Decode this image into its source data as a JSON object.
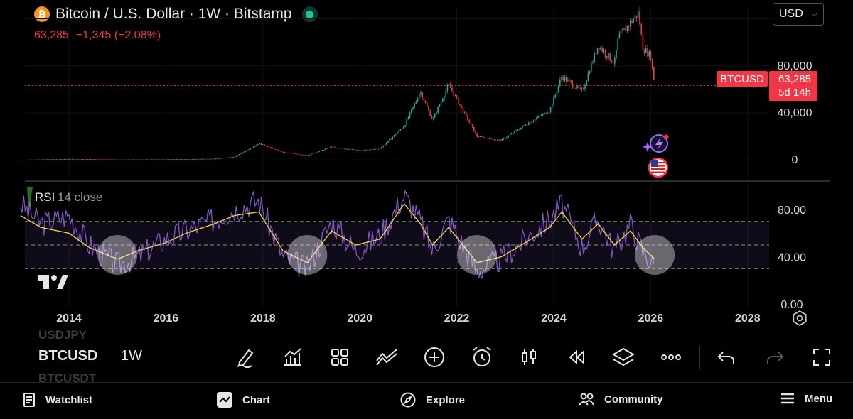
{
  "header": {
    "btc_symbol": "₿",
    "title": "Bitcoin / U.S. Dollar · 1W · Bitstamp",
    "last_price": "63,285",
    "change": "−1,345 (−2.08%)"
  },
  "currency_select": {
    "value": "USD"
  },
  "price_badge": {
    "symbol": "BTCUSD",
    "price": "63,285",
    "countdown": "5d 14h"
  },
  "price_axis": {
    "labels": [
      "80,000",
      "40,000",
      "0"
    ]
  },
  "rsi_axis": {
    "labels": [
      "80.00",
      "40.00",
      "0.00"
    ]
  },
  "rsi_legend": {
    "name": "RSI",
    "params": "14 close"
  },
  "time_axis": {
    "labels": [
      "2014",
      "2016",
      "2018",
      "2020",
      "2022",
      "2024",
      "2026",
      "2028"
    ]
  },
  "toolbar": {
    "symbol": "BTCUSD",
    "interval": "1W",
    "ghost_above": "USDJPY",
    "ghost_below": "BTCUSDT"
  },
  "bottom_nav": {
    "watchlist": "Watchlist",
    "chart": "Chart",
    "explore": "Explore",
    "community": "Community",
    "menu": "Menu"
  },
  "colors": {
    "up": "#26a69a",
    "down": "#f23645",
    "rsi_line": "#7e57c2",
    "rsi_ma": "#f5d742",
    "background": "#000000"
  },
  "chart_data": [
    {
      "type": "line",
      "series": [
        {
          "x": [
            "2013-01",
            "2014-01",
            "2015-01",
            "2016-01",
            "2017-01",
            "2017-06",
            "2017-12",
            "2018-06",
            "2018-12",
            "2019-06",
            "2020-01",
            "2020-06",
            "2020-12",
            "2021-04",
            "2021-07",
            "2021-11",
            "2022-06",
            "2022-12",
            "2023-06",
            "2023-12",
            "2024-03",
            "2024-08",
            "2024-12",
            "2025-04",
            "2025-05",
            "2025-08",
            "2025-10",
            "2025-11",
            "2026-01",
            "2026-02"
          ],
          "values": [
            13,
            800,
            300,
            430,
            1000,
            2500,
            14000,
            6500,
            3800,
            11000,
            8000,
            9500,
            29000,
            58000,
            34000,
            64000,
            20000,
            16500,
            30000,
            42000,
            71000,
            58000,
            98000,
            82000,
            104000,
            117000,
            125000,
            96000,
            88000,
            63285
          ]
        }
      ],
      "ylim": [
        -15000,
        130000
      ],
      "last": 63285
    },
    {
      "type": "line",
      "series": [
        {
          "x": [
            "2013-01",
            "2013-06",
            "2014-01",
            "2014-06",
            "2015-01",
            "2015-06",
            "2016-01",
            "2016-06",
            "2017-01",
            "2017-06",
            "2017-12",
            "2018-06",
            "2018-12",
            "2019-06",
            "2019-12",
            "2020-06",
            "2020-12",
            "2021-04",
            "2021-07",
            "2021-11",
            "2022-06",
            "2022-12",
            "2023-06",
            "2023-12",
            "2024-03",
            "2024-08",
            "2024-12",
            "2025-04",
            "2025-08",
            "2025-11",
            "2026-02"
          ],
          "values": [
            85,
            68,
            75,
            50,
            33,
            40,
            55,
            62,
            72,
            80,
            88,
            40,
            30,
            70,
            45,
            58,
            92,
            70,
            45,
            72,
            28,
            38,
            55,
            72,
            85,
            48,
            72,
            45,
            68,
            45,
            32
          ]
        }
      ],
      "ma_values": [
        75,
        65,
        60,
        48,
        38,
        45,
        52,
        60,
        68,
        75,
        78,
        45,
        35,
        62,
        50,
        55,
        85,
        68,
        50,
        65,
        35,
        40,
        52,
        65,
        78,
        55,
        68,
        50,
        62,
        48,
        38
      ],
      "levels": [
        70,
        50,
        30
      ],
      "ylim": [
        0,
        100
      ]
    }
  ]
}
